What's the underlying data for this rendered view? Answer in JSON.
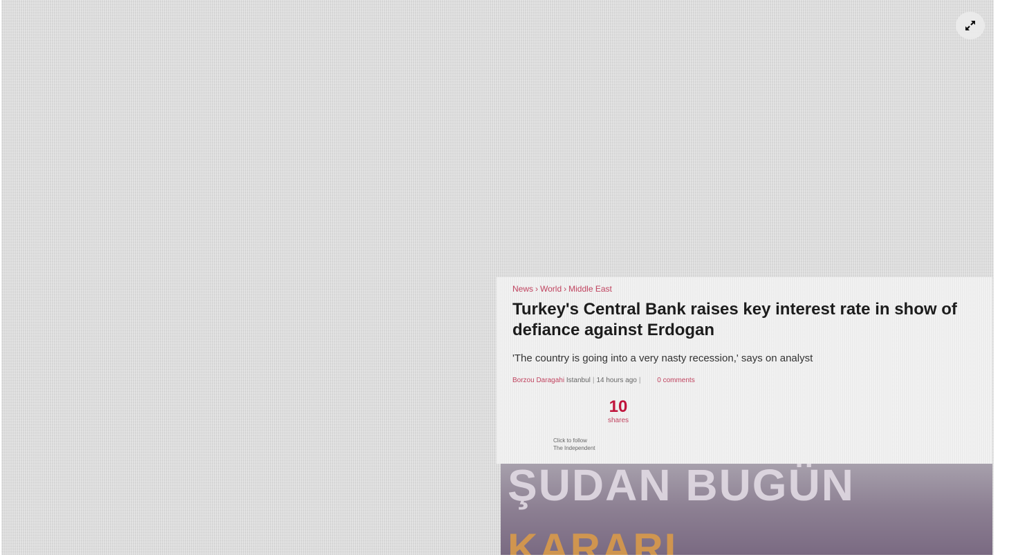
{
  "viewer": {
    "expand_icon": "expand-arrows-icon"
  },
  "article": {
    "breadcrumb": [
      "News",
      "World",
      "Middle East"
    ],
    "headline": "Turkey's Central Bank raises key interest rate in show of defiance against Erdogan",
    "standfirst": "'The country is going into a very nasty recession,' says on analyst",
    "byline": {
      "author": "Borzou Daragahi",
      "location": "Istanbul",
      "time": "14 hours ago",
      "comments": "0 comments"
    },
    "shares": {
      "count": "10",
      "label": "shares"
    },
    "follow": {
      "line1": "Click to follow",
      "line2": "The Independent"
    }
  },
  "photo": {
    "banner_text_top": "ŞUDAN BUGÜN",
    "banner_text_bottom": "KARARI"
  },
  "colors": {
    "accent": "#c0435f",
    "share_count": "#c0143c",
    "viewer_bg": "#dadada"
  }
}
